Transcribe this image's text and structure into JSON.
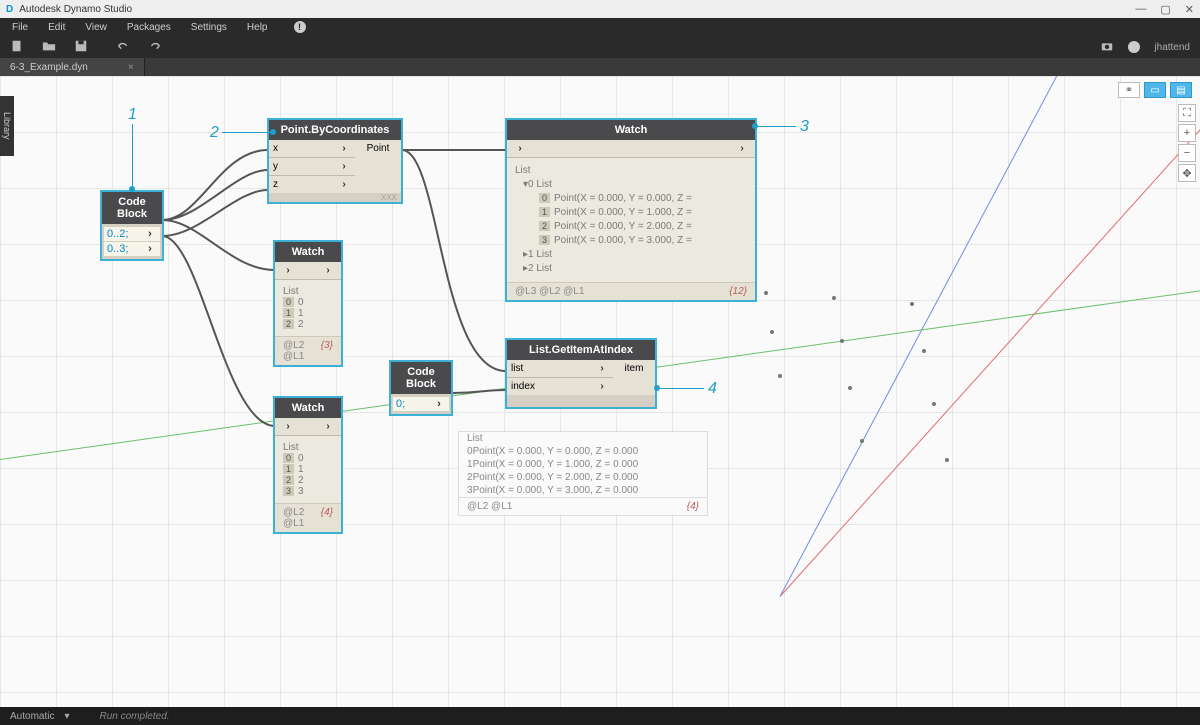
{
  "titlebar": {
    "app": "Autodesk Dynamo Studio"
  },
  "menu": [
    "File",
    "Edit",
    "View",
    "Packages",
    "Settings",
    "Help"
  ],
  "user": "jhattend",
  "tab": {
    "name": "6-3_Example.dyn"
  },
  "library_label": "Library",
  "callouts": {
    "c1": "1",
    "c2": "2",
    "c3": "3",
    "c4": "4"
  },
  "nodes": {
    "cb1": {
      "title": "Code Block",
      "lines": [
        "0..2;",
        "0..3;"
      ]
    },
    "pbc": {
      "title": "Point.ByCoordinates",
      "in": [
        "x",
        "y",
        "z"
      ],
      "out": "Point",
      "lacing": "XXX"
    },
    "watchA": {
      "title": "Watch",
      "header": "List",
      "rows": [
        [
          "0",
          "0"
        ],
        [
          "1",
          "1"
        ],
        [
          "2",
          "2"
        ]
      ],
      "foot_left": "@L2 @L1",
      "foot_right": "{3}"
    },
    "watchB": {
      "title": "Watch",
      "header": "List",
      "rows": [
        [
          "0",
          "0"
        ],
        [
          "1",
          "1"
        ],
        [
          "2",
          "2"
        ],
        [
          "3",
          "3"
        ]
      ],
      "foot_left": "@L2 @L1",
      "foot_right": "{4}"
    },
    "watchBig": {
      "title": "Watch",
      "header": "List",
      "group0": "0 List",
      "lines": [
        "Point(X = 0.000, Y = 0.000, Z =",
        "Point(X = 0.000, Y = 1.000, Z =",
        "Point(X = 0.000, Y = 2.000, Z =",
        "Point(X = 0.000, Y = 3.000, Z ="
      ],
      "idx": [
        "0",
        "1",
        "2",
        "3"
      ],
      "othergroups": [
        "1 List",
        "2 List"
      ],
      "foot_left": "@L3 @L2 @L1",
      "foot_right": "{12}"
    },
    "cb2": {
      "title": "Code Block",
      "lines": [
        "0;"
      ]
    },
    "getitem": {
      "title": "List.GetItemAtIndex",
      "in": [
        "list",
        "index"
      ],
      "out": "item"
    }
  },
  "preview": {
    "header": "List",
    "lines": [
      "Point(X = 0.000, Y = 0.000, Z = 0.000",
      "Point(X = 0.000, Y = 1.000, Z = 0.000",
      "Point(X = 0.000, Y = 2.000, Z = 0.000",
      "Point(X = 0.000, Y = 3.000, Z = 0.000"
    ],
    "idx": [
      "0",
      "1",
      "2",
      "3"
    ],
    "foot_left": "@L2 @L1",
    "foot_right": "{4}"
  },
  "status": {
    "mode": "Automatic",
    "msg": "Run completed."
  }
}
